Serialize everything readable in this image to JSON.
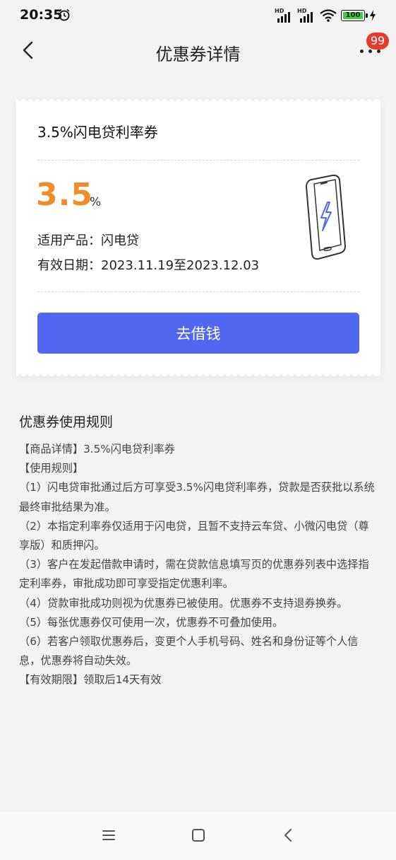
{
  "status_bar": {
    "time": "20:35",
    "alarm_icon": "alarm-clock-icon",
    "signal1_label": "HD",
    "signal2_label": "HD",
    "battery_level": "100",
    "charging_icon": "lightning-bolt-icon"
  },
  "nav": {
    "back_icon": "chevron-left-icon",
    "title": "优惠券详情",
    "more_icon": "more-dots-icon",
    "badge_count": "99"
  },
  "coupon": {
    "title": "3.5%闪电贷利率券",
    "rate_value": "3.5",
    "rate_unit": "%",
    "product_line": "适用产品：闪电贷",
    "validity_line": "有效日期：2023.11.19至2023.12.03",
    "illustration_icon": "phone-lightning-icon",
    "button_label": "去借钱",
    "colors": {
      "rate": "#f08c2b",
      "button": "#5068f0"
    }
  },
  "rules": {
    "heading": "优惠券使用规则",
    "lines": [
      "【商品详情】3.5%闪电贷利率券",
      "【使用规则】",
      "（1）闪电贷审批通过后方可享受3.5%闪电贷利率券，贷款是否获批以系统最终审批结果为准。",
      "（2）本指定利率券仅适用于闪电贷，且暂不支持云车贷、小微闪电贷（尊享版）和质押闪。",
      "（3）客户在发起借款申请时，需在贷款信息填写页的优惠券列表中选择指定利率券，审批成功即可享受指定优惠利率。",
      "（4）贷款审批成功则视为优惠券已被使用。优惠券不支持退券换券。",
      "（5）每张优惠券仅可使用一次，优惠券不可叠加使用。",
      "（6）若客户领取优惠券后，变更个人手机号码、姓名和身份证等个人信息，优惠券将自动失效。",
      "【有效期限】领取后14天有效"
    ]
  },
  "system_nav": {
    "menu_icon": "menu-lines-icon",
    "home_icon": "home-square-icon",
    "back_icon": "back-triangle-icon"
  }
}
